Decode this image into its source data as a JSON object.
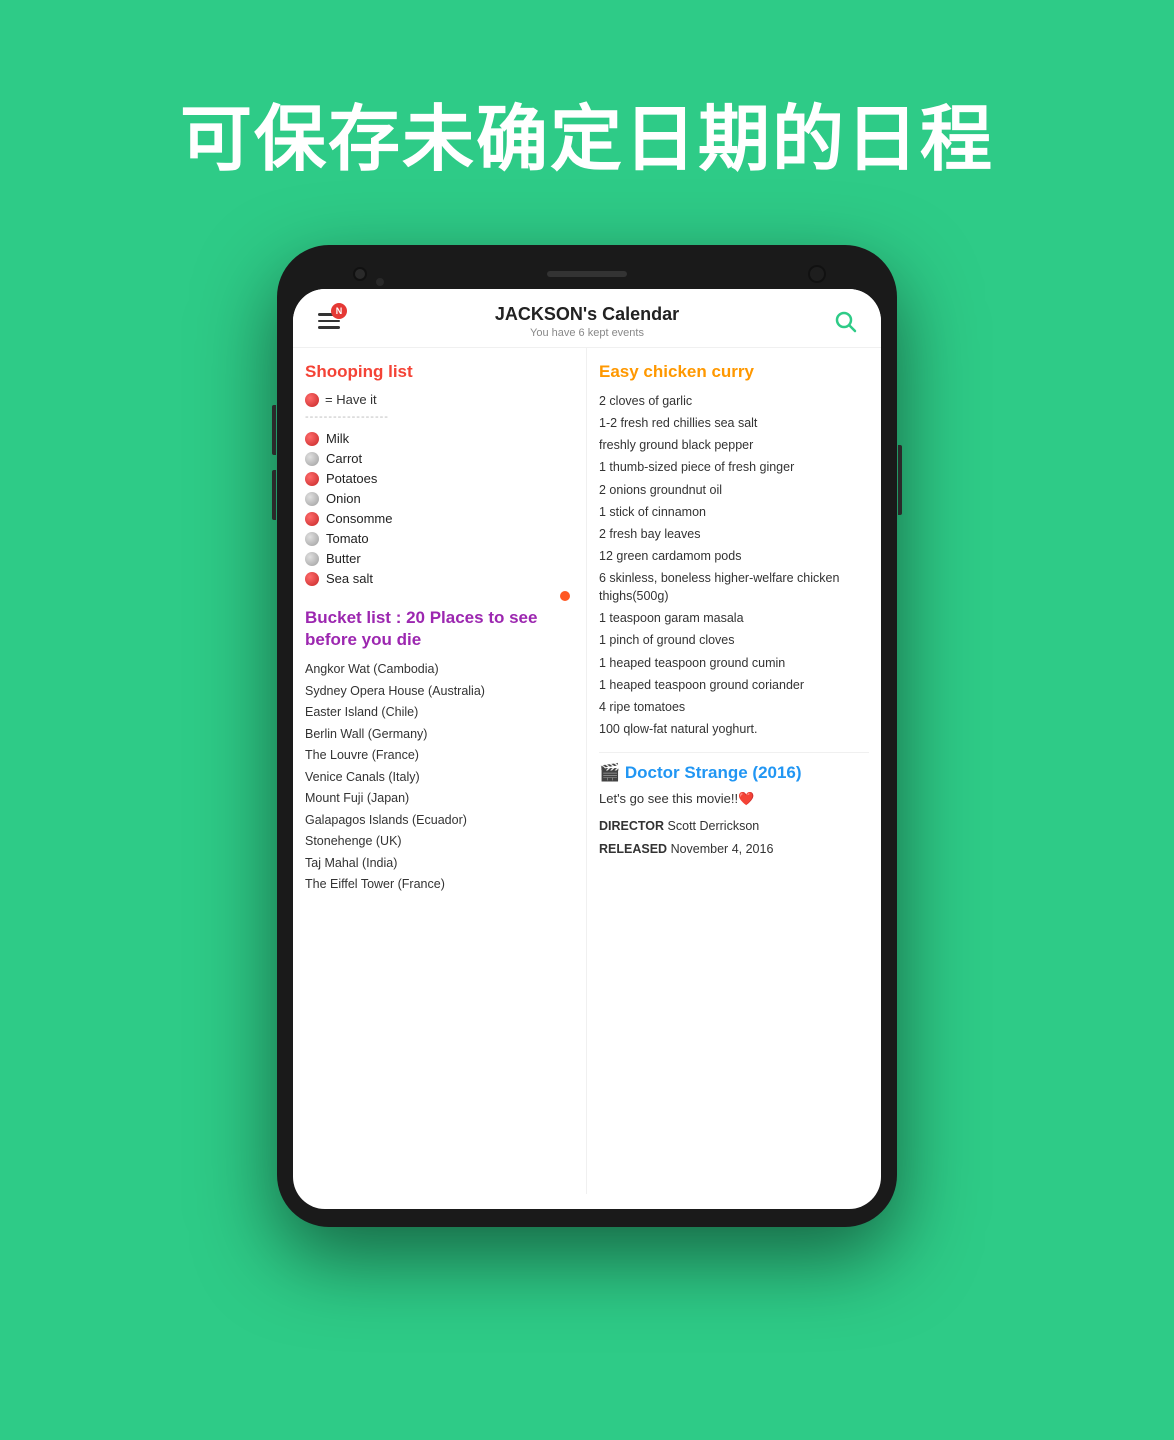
{
  "page": {
    "background_color": "#2ecb87",
    "hero_title": "可保存未确定日期的日程"
  },
  "app": {
    "header": {
      "title": "JACKSON's Calendar",
      "subtitle": "You have 6 kept events",
      "notification_count": "N"
    },
    "left_column": {
      "shopping_section": {
        "title": "Shooping list",
        "legend_text": "= Have it",
        "divider": "------------------",
        "items": [
          {
            "name": "Milk",
            "have": true
          },
          {
            "name": "Carrot",
            "have": false
          },
          {
            "name": "Potatoes",
            "have": true
          },
          {
            "name": "Onion",
            "have": false
          },
          {
            "name": "Consomme",
            "have": true
          },
          {
            "name": "Tomato",
            "have": false
          },
          {
            "name": "Butter",
            "have": false
          },
          {
            "name": "Sea salt",
            "have": true
          }
        ]
      },
      "bucket_section": {
        "title": "Bucket list : 20 Places to see before you die",
        "items": [
          "Angkor Wat (Cambodia)",
          "Sydney Opera House (Australia)",
          "Easter Island (Chile)",
          "Berlin Wall (Germany)",
          "The Louvre (France)",
          "Venice Canals (Italy)",
          "Mount Fuji (Japan)",
          "Galapagos Islands (Ecuador)",
          "Stonehenge (UK)",
          "Taj Mahal (India)",
          "The Eiffel Tower (France)"
        ]
      }
    },
    "right_column": {
      "recipe_section": {
        "title": "Easy chicken curry",
        "ingredients": [
          "2 cloves of garlic",
          "1-2 fresh red chillies sea salt",
          "freshly ground black pepper",
          "1 thumb-sized piece of fresh ginger",
          "2 onions groundnut oil",
          "1 stick of cinnamon",
          "2 fresh bay leaves",
          "12 green cardamom pods",
          "6 skinless, boneless higher-welfare chicken thighs(500g)",
          "1 teaspoon garam masala",
          "1 pinch of ground cloves",
          "1 heaped teaspoon ground cumin",
          "1 heaped teaspoon ground coriander",
          "4 ripe tomatoes",
          "100 qlow-fat natural yoghurt."
        ]
      },
      "movie_section": {
        "title": "🎬 Doctor Strange (2016)",
        "lets_go": "Let's go see this movie!!❤️",
        "director_label": "DIRECTOR",
        "director_value": "Scott Derrickson",
        "released_label": "RELEASED",
        "released_value": "November 4, 2016"
      }
    }
  }
}
